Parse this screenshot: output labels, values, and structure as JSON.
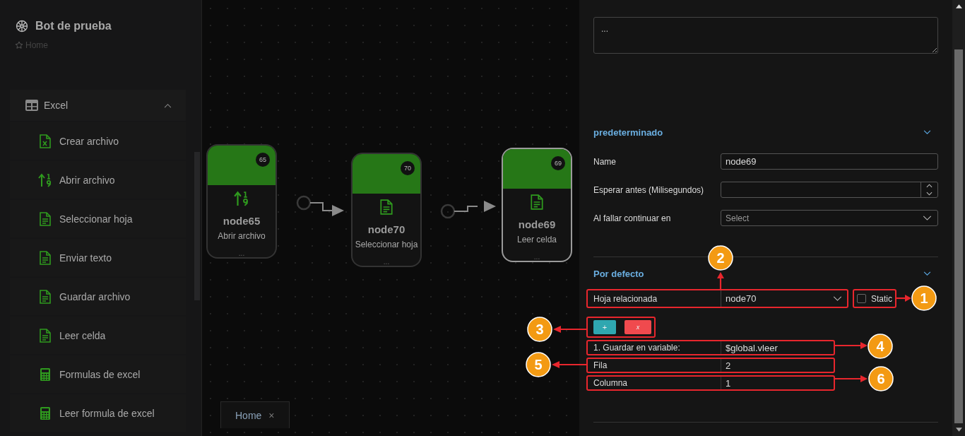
{
  "sidebar": {
    "title": "Bot de prueba",
    "breadcrumb": "Home",
    "group": {
      "label": "Excel",
      "expanded": true,
      "items": [
        {
          "label": "Crear archivo",
          "kind": "create"
        },
        {
          "label": "Abrir archivo",
          "kind": "open"
        },
        {
          "label": "Seleccionar hoja",
          "kind": "sheet"
        },
        {
          "label": "Enviar texto",
          "kind": "sheet"
        },
        {
          "label": "Guardar archivo",
          "kind": "sheet"
        },
        {
          "label": "Leer celda",
          "kind": "sheet"
        },
        {
          "label": "Formulas de excel",
          "kind": "formula"
        },
        {
          "label": "Leer formula de excel",
          "kind": "formula"
        }
      ]
    }
  },
  "canvas": {
    "nodes": [
      {
        "badge": "65",
        "name": "node65",
        "action": "Abrir archivo",
        "footer": "...",
        "kind": "open",
        "selected": false
      },
      {
        "badge": "70",
        "name": "node70",
        "action": "Seleccionar hoja",
        "footer": "...",
        "kind": "sheet",
        "selected": false
      },
      {
        "badge": "69",
        "name": "node69",
        "action": "Leer celda",
        "footer": "...",
        "kind": "sheet",
        "selected": true
      }
    ],
    "tabs": [
      {
        "label": "Home",
        "close": "×",
        "selected": true
      }
    ]
  },
  "panel": {
    "description": "...",
    "sections": [
      {
        "title": "predeterminado",
        "fields": [
          {
            "kind": "text",
            "label": "Name",
            "value": "node69"
          },
          {
            "kind": "number",
            "label": "Esperar antes (Milisegundos)"
          },
          {
            "kind": "select",
            "label": "Al fallar continuar en",
            "placeholder": "Select"
          }
        ]
      },
      {
        "title": "Por defecto",
        "related": {
          "label": "Hoja relacionada",
          "value": "node70",
          "static": {
            "label": "Static",
            "checked": false
          }
        },
        "buttons": [
          {
            "kind": "add",
            "label": "+"
          },
          {
            "kind": "remove",
            "label": "x"
          }
        ],
        "fields": [
          {
            "label": "1. Guardar en variable:",
            "value": "$global.vleer"
          },
          {
            "label": "Fila",
            "value": "2"
          },
          {
            "label": "Columna",
            "value": "1"
          }
        ]
      }
    ]
  },
  "callouts": [
    {
      "number": "1"
    },
    {
      "number": "2"
    },
    {
      "number": "3"
    },
    {
      "number": "4"
    },
    {
      "number": "5"
    },
    {
      "number": "6"
    }
  ]
}
